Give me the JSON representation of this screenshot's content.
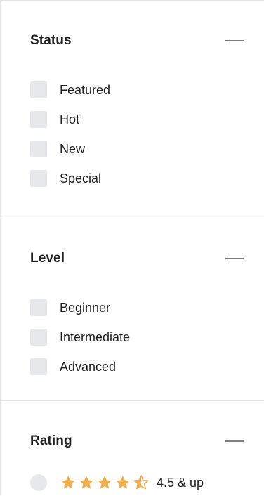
{
  "filters": {
    "status": {
      "title": "Status",
      "options": [
        "Featured",
        "Hot",
        "New",
        "Special"
      ]
    },
    "level": {
      "title": "Level",
      "options": [
        "Beginner",
        "Intermediate",
        "Advanced"
      ]
    },
    "rating": {
      "title": "Rating",
      "option_label": "4.5 & up",
      "stars_value": 4.5,
      "stars_max": 5,
      "star_color": "#f0ad4e"
    }
  },
  "icons": {
    "collapse": "minus-icon",
    "star": "star-icon",
    "half_star": "star-half-icon"
  },
  "colors": {
    "checkbox_bg": "#e6e8ec",
    "divider": "#e6e6e6",
    "collapse_icon": "#7d7d7d"
  }
}
